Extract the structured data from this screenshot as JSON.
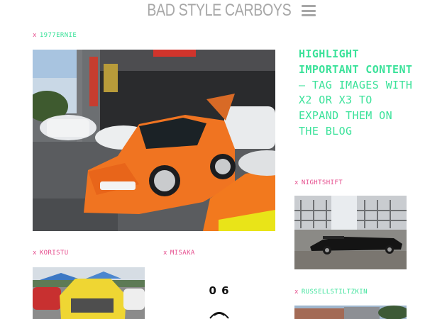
{
  "header": {
    "title": "BAD STYLE CARBOYS",
    "menu_icon": "hamburger-menu-icon"
  },
  "colors": {
    "accent_green": "#3be29a",
    "accent_pink": "#e54b8c",
    "title_gray": "#a7a7a7"
  },
  "posts": [
    {
      "marker": "x",
      "author": "1977ERNIE"
    },
    {
      "marker": "x",
      "author": "KORISTU"
    },
    {
      "marker": "x",
      "author": "MISAKA"
    },
    {
      "marker": "x",
      "author": "NIGHTSHIFT"
    },
    {
      "marker": "x",
      "author": "RUSSELLSTILTZKIN"
    }
  ],
  "highlight": {
    "bold": "HIGHLIGHT IMPORTANT CONTENT",
    "rest": " — TAG IMAGES WITH X2 OR X3 TO EXPAND THEM ON THE BLOG"
  },
  "illustration": {
    "text": "0 6"
  }
}
